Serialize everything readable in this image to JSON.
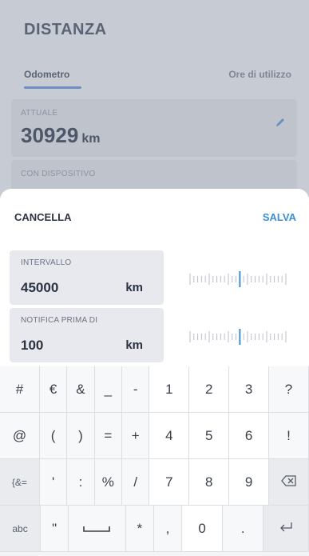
{
  "background": {
    "title": "DISTANZA",
    "tabs": [
      {
        "label": "Odometro",
        "active": true
      },
      {
        "label": "Ore di utilizzo",
        "active": false
      }
    ],
    "current": {
      "label": "ATTUALE",
      "value": "30929",
      "unit": "km"
    },
    "device": {
      "label": "CON DISPOSITIVO"
    }
  },
  "sheet": {
    "cancel_label": "CANCELLA",
    "save_label": "SALVA",
    "fields": [
      {
        "label": "INTERVALLO",
        "value": "45000",
        "unit": "km"
      },
      {
        "label": "NOTIFICA PRIMA DI",
        "value": "100",
        "unit": "km"
      }
    ]
  },
  "keyboard": {
    "rows": [
      [
        "#",
        "€",
        "&",
        "_",
        "-",
        "1",
        "2",
        "3",
        "?"
      ],
      [
        "@",
        "(",
        ")",
        "=",
        "+",
        "4",
        "5",
        "6",
        "!"
      ],
      [
        "{&=",
        "'",
        ":",
        "%",
        "/",
        "7",
        "8",
        "9",
        "backspace-icon"
      ],
      [
        "abc",
        "\"",
        "space-icon",
        "*",
        ",",
        "0",
        ".",
        "enter-icon"
      ]
    ]
  },
  "colors": {
    "accent": "#3b8ed6",
    "ruler_highlight": "#3b8ed6"
  }
}
